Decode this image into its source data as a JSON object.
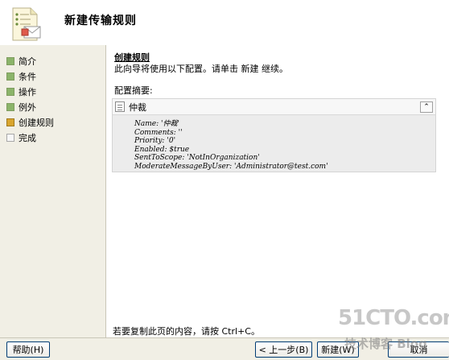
{
  "header": {
    "title": "新建传输规则"
  },
  "steps": [
    {
      "label": "简介",
      "state": "done"
    },
    {
      "label": "条件",
      "state": "done"
    },
    {
      "label": "操作",
      "state": "done"
    },
    {
      "label": "例外",
      "state": "done"
    },
    {
      "label": "创建规则",
      "state": "current"
    },
    {
      "label": "完成",
      "state": "pending"
    }
  ],
  "main": {
    "section_title": "创建规则",
    "description": "此向导将使用以下配置。请单击 新建 继续。",
    "summary_label": "配置摘要:",
    "rule_name": "仲裁",
    "collapse_glyph": "⌃",
    "properties": [
      "Name: '仲裁'",
      "Comments: ''",
      "Priority: '0'",
      "Enabled: $true",
      "SentToScope: 'NotInOrganization'",
      "ModerateMessageByUser: 'Administrator@test.com'"
    ],
    "copy_hint": "若要复制此页的内容，请按 Ctrl+C。"
  },
  "footer": {
    "help_label": "帮助(H)",
    "back_label": "< 上一步(B)",
    "new_label": "新建(W)",
    "cancel_label": "取消"
  },
  "watermark": {
    "line1": "51CTO.com",
    "line2": "技术博客 Blog"
  },
  "colors": {
    "done": "#8bb46a",
    "current": "#d9a52e",
    "pending": "#f7f7f7",
    "panel": "#f1efe5"
  }
}
